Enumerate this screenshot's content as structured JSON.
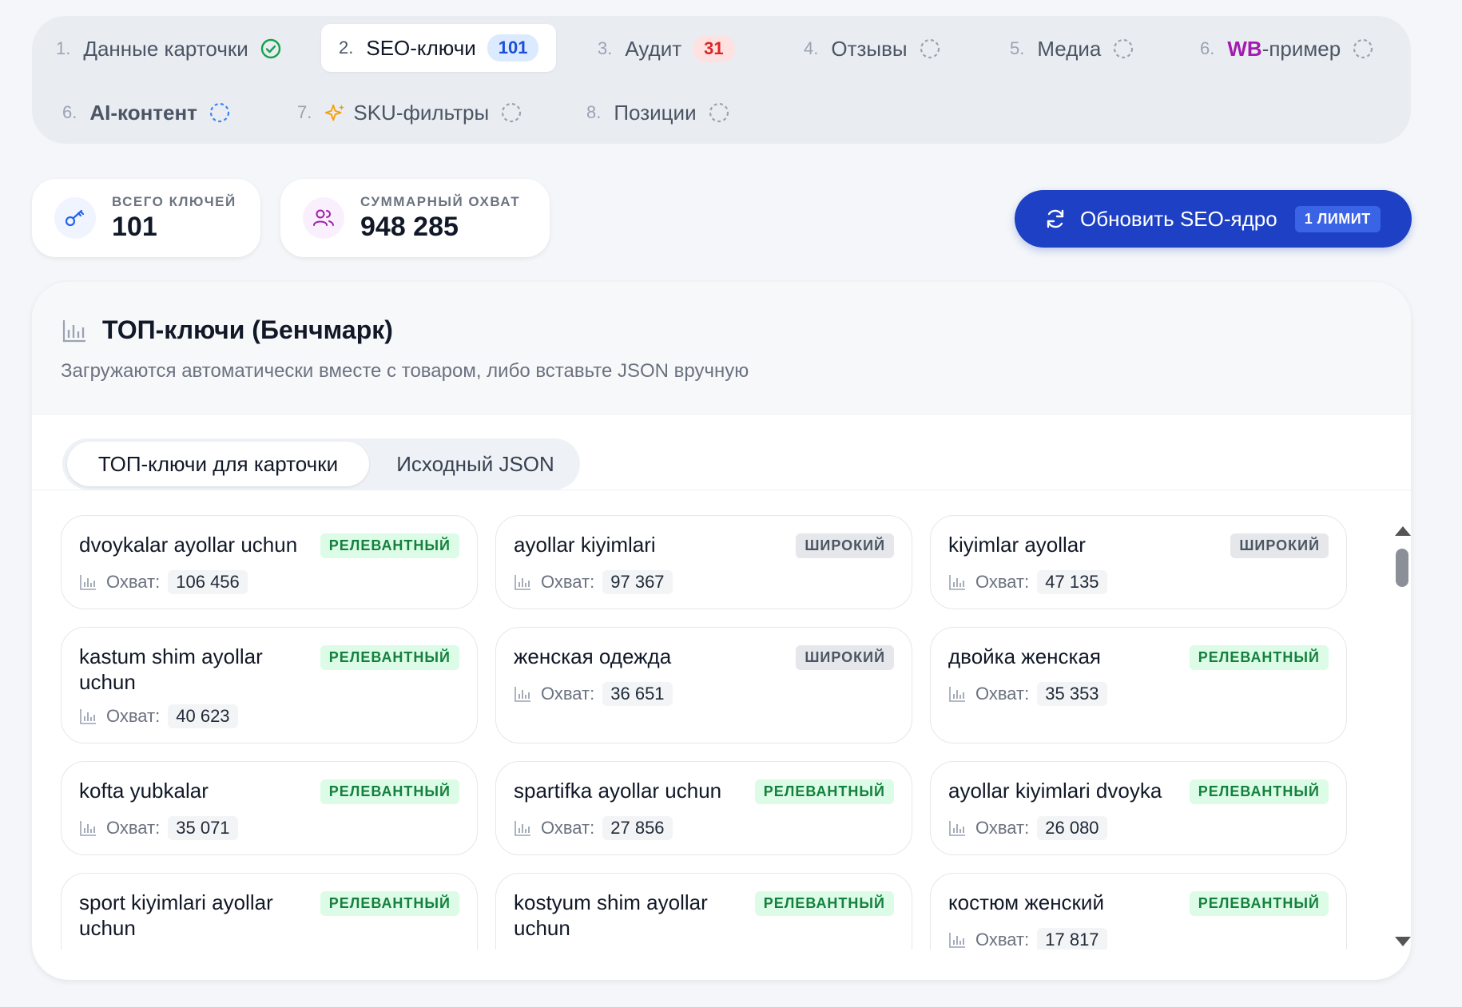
{
  "steps": [
    {
      "num": "1.",
      "label": "Данные карточки",
      "status": "done"
    },
    {
      "num": "2.",
      "label": "SEO-ключи",
      "badge": "101",
      "active": true
    },
    {
      "num": "3.",
      "label": "Аудит",
      "badge": "31"
    },
    {
      "num": "4.",
      "label": "Отзывы",
      "status": "pending"
    },
    {
      "num": "5.",
      "label": "Медиа",
      "status": "pending"
    },
    {
      "num": "6.",
      "label_brand": "WB",
      "label": "-пример",
      "status": "pending"
    },
    {
      "num": "6.",
      "label": "AI-контент",
      "status": "pending"
    },
    {
      "num": "7.",
      "label": "SKU-фильтры",
      "status": "pending",
      "icon": "sparkle-icon"
    },
    {
      "num": "8.",
      "label": "Позиции",
      "status": "pending"
    }
  ],
  "stats": {
    "total_keys": {
      "caption": "ВСЕГО КЛЮЧЕЙ",
      "value": "101",
      "icon": "key-icon"
    },
    "total_reach": {
      "caption": "СУММАРНЫЙ ОХВАТ",
      "value": "948 285",
      "icon": "users-icon"
    }
  },
  "refresh_button": {
    "label": "Обновить SEO-ядро",
    "badge": "1 ЛИМИТ"
  },
  "panel": {
    "title": "ТОП-ключи (Бенчмарк)",
    "subtitle": "Загружаются автоматически вместе с товаром, либо вставьте JSON вручную",
    "tabs": [
      "ТОП-ключи для карточки",
      "Исходный JSON"
    ],
    "reach_label": "Охват:"
  },
  "keywords": [
    {
      "name": "dvoykalar ayollar uchun",
      "tag": "РЕЛЕВАНТНЫЙ",
      "kind": "rel",
      "reach": "106 456"
    },
    {
      "name": "ayollar kiyimlari",
      "tag": "ШИРОКИЙ",
      "kind": "wide",
      "reach": "97 367"
    },
    {
      "name": "kiyimlar ayollar",
      "tag": "ШИРОКИЙ",
      "kind": "wide",
      "reach": "47 135"
    },
    {
      "name": "kastum shim ayollar uchun",
      "tag": "РЕЛЕВАНТНЫЙ",
      "kind": "rel",
      "reach": "40 623"
    },
    {
      "name": "женская одежда",
      "tag": "ШИРОКИЙ",
      "kind": "wide",
      "reach": "36 651"
    },
    {
      "name": "двойка женская",
      "tag": "РЕЛЕВАНТНЫЙ",
      "kind": "rel",
      "reach": "35 353"
    },
    {
      "name": "kofta yubkalar",
      "tag": "РЕЛЕВАНТНЫЙ",
      "kind": "rel",
      "reach": "35 071"
    },
    {
      "name": "spartifka ayollar uchun",
      "tag": "РЕЛЕВАНТНЫЙ",
      "kind": "rel",
      "reach": "27 856"
    },
    {
      "name": "ayollar kiyimlari dvoyka",
      "tag": "РЕЛЕВАНТНЫЙ",
      "kind": "rel",
      "reach": "26 080"
    },
    {
      "name": "sport kiyimlari ayollar uchun",
      "tag": "РЕЛЕВАНТНЫЙ",
      "kind": "rel",
      "reach": ""
    },
    {
      "name": "kostyum shim ayollar uchun",
      "tag": "РЕЛЕВАНТНЫЙ",
      "kind": "rel",
      "reach": ""
    },
    {
      "name": "костюм женский",
      "tag": "РЕЛЕВАНТНЫЙ",
      "kind": "rel",
      "reach": "17 817"
    }
  ],
  "colors": {
    "accent": "#1d40c4",
    "relevant": "#15803d",
    "wide": "#4b5563",
    "brand": "#a21caf"
  }
}
